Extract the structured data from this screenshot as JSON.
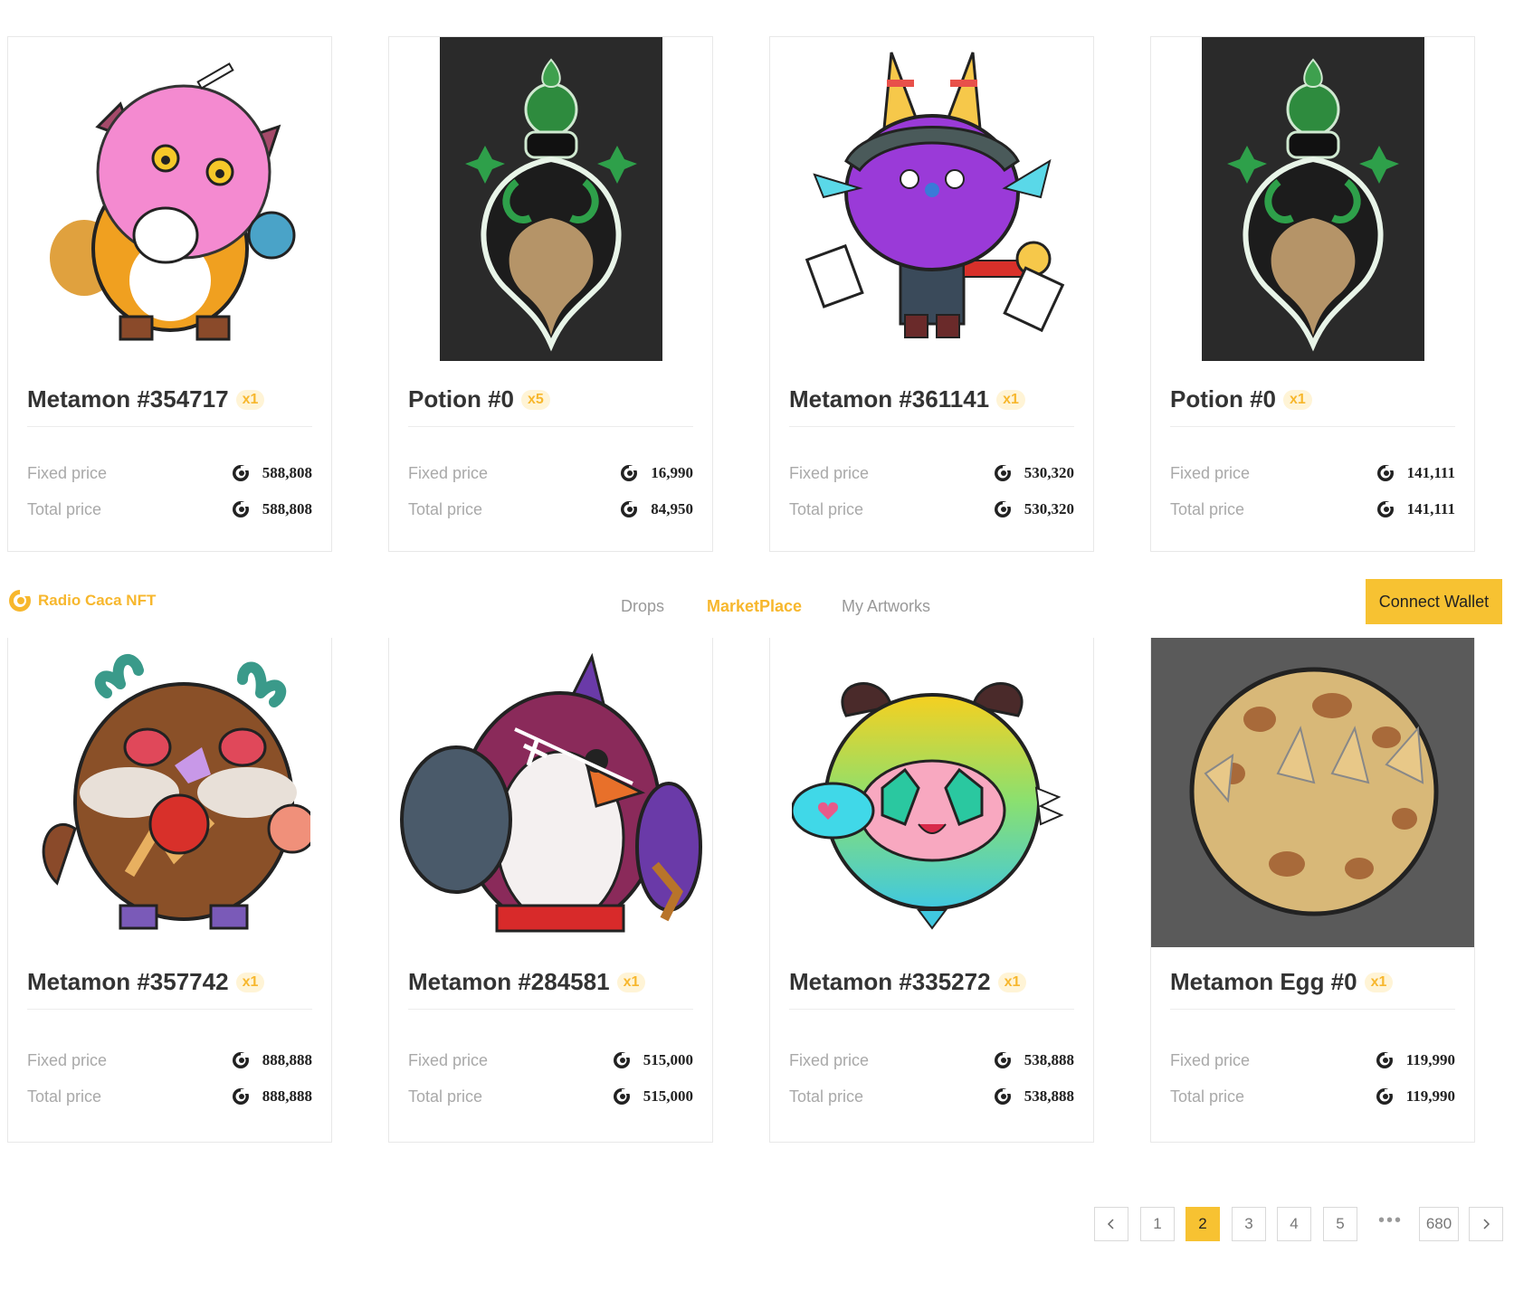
{
  "nav": {
    "brand": "Radio Caca NFT",
    "links": [
      "Drops",
      "MarketPlace",
      "My Artworks"
    ],
    "active": "MarketPlace",
    "connect_wallet": "Connect Wallet"
  },
  "labels": {
    "fixed": "Fixed price",
    "total": "Total price"
  },
  "cards": [
    {
      "title": "Metamon #354717",
      "qty": "x1",
      "fixed": "588,808",
      "total": "588,808",
      "image": "pink-metamon-art"
    },
    {
      "title": "Potion #0",
      "qty": "x5",
      "fixed": "16,990",
      "total": "84,950",
      "image": "potion-art"
    },
    {
      "title": "Metamon #361141",
      "qty": "x1",
      "fixed": "530,320",
      "total": "530,320",
      "image": "purple-metamon-art"
    },
    {
      "title": "Potion #0",
      "qty": "x1",
      "fixed": "141,111",
      "total": "141,111",
      "image": "potion-art"
    },
    {
      "title": "Metamon #357742",
      "qty": "x1",
      "fixed": "888,888",
      "total": "888,888",
      "image": "deer-metamon-art"
    },
    {
      "title": "Metamon #284581",
      "qty": "x1",
      "fixed": "515,000",
      "total": "515,000",
      "image": "penguin-metamon-art"
    },
    {
      "title": "Metamon #335272",
      "qty": "x1",
      "fixed": "538,888",
      "total": "538,888",
      "image": "rainbow-metamon-art"
    },
    {
      "title": "Metamon Egg #0",
      "qty": "x1",
      "fixed": "119,990",
      "total": "119,990",
      "image": "egg-art"
    }
  ],
  "pagination": {
    "pages": [
      "1",
      "2",
      "3",
      "4",
      "5",
      "680"
    ],
    "current": "2",
    "ellipsis": "•••"
  },
  "colors": {
    "accent": "#f7b72d",
    "button": "#f7c232",
    "potion_bg": "#2a2a2a",
    "egg_bg": "#5a5a5a"
  }
}
